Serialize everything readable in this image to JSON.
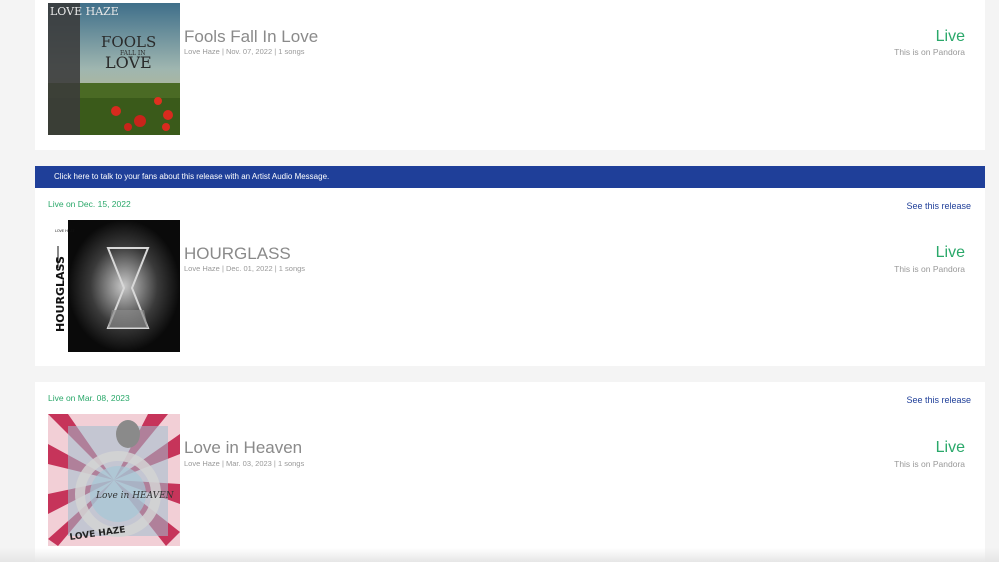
{
  "banner": {
    "text": "Click here to talk to your fans about this release with an Artist Audio Message."
  },
  "releases": [
    {
      "title": "Fools Fall In Love",
      "meta": "Love Haze | Nov. 07, 2022 | 1 songs",
      "status": "Live",
      "dsp": "This is on Pandora",
      "art_text": {
        "line1": "FOOLS",
        "line2": "FALL IN",
        "line3": "LOVE",
        "side": "LOVE HAZE"
      }
    },
    {
      "live_date": "Live on Dec. 15, 2022",
      "see_link": "See this release",
      "title": "HOURGLASS",
      "meta": "Love Haze | Dec. 01, 2022 | 1 songs",
      "status": "Live",
      "dsp": "This is on Pandora",
      "art_text": {
        "side": "HOURGLASS",
        "top": "LOVE HAZE"
      }
    },
    {
      "live_date": "Live on Mar. 08, 2023",
      "see_link": "See this release",
      "title": "Love in Heaven",
      "meta": "Love Haze | Mar. 03, 2023 | 1 songs",
      "status": "Live",
      "dsp": "This is on Pandora",
      "art_text": {
        "center": "Love in HEAVEN",
        "bottom": "LOVE HAZE"
      }
    }
  ],
  "colors": {
    "live": "#2aa86a",
    "link": "#1f3f99",
    "banner": "#1f3f99"
  }
}
